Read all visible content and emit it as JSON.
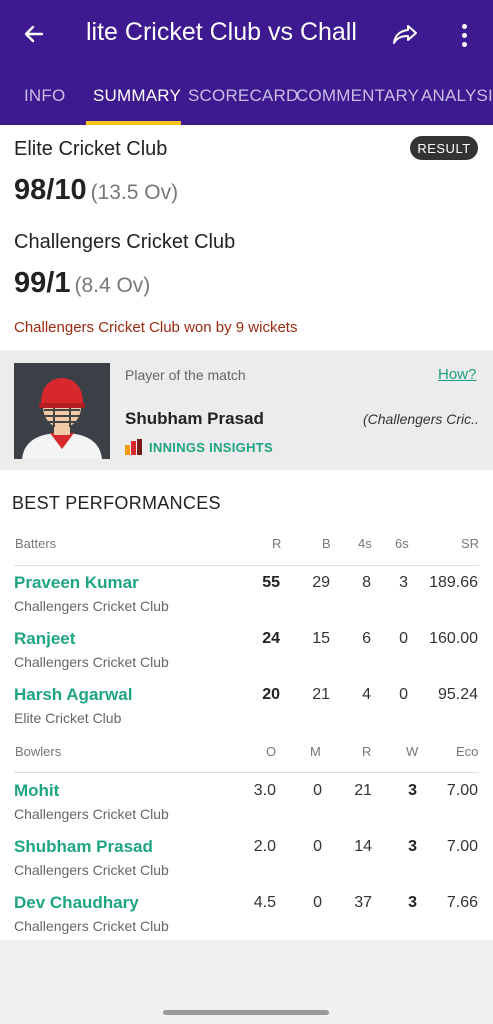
{
  "header": {
    "title": "lite Cricket Club vs Chall",
    "tabs": [
      "INFO",
      "SUMMARY",
      "SCORECARD",
      "COMMENTARY",
      "ANALYSIS"
    ],
    "active_tab": "SUMMARY",
    "accent": "#3d1a8f",
    "tab_highlight": "#f5c518"
  },
  "summary": {
    "team1": {
      "name": "Elite Cricket Club",
      "score": "98/10",
      "overs": "(13.5 Ov)"
    },
    "team2": {
      "name": "Challengers Cricket Club",
      "score": "99/1",
      "overs": "(8.4 Ov)"
    },
    "badge": "RESULT",
    "result": "Challengers Cricket Club won by 9 wickets"
  },
  "potm": {
    "label": "Player of the match",
    "how": "How?",
    "name": "Shubham Prasad",
    "team": "(Challengers Cric..",
    "insights": "INNINGS INSIGHTS"
  },
  "best": {
    "title": "BEST PERFORMANCES",
    "batters_header": {
      "label": "Batters",
      "r": "R",
      "b": "B",
      "fours": "4s",
      "sixes": "6s",
      "sr": "SR"
    },
    "batters": [
      {
        "name": "Praveen Kumar",
        "team": "Challengers Cricket Club",
        "r": "55",
        "b": "29",
        "fours": "8",
        "sixes": "3",
        "sr": "189.66"
      },
      {
        "name": "Ranjeet",
        "team": "Challengers Cricket Club",
        "r": "24",
        "b": "15",
        "fours": "6",
        "sixes": "0",
        "sr": "160.00"
      },
      {
        "name": "Harsh Agarwal",
        "team": "Elite Cricket Club",
        "r": "20",
        "b": "21",
        "fours": "4",
        "sixes": "0",
        "sr": "95.24"
      }
    ],
    "bowlers_header": {
      "label": "Bowlers",
      "o": "O",
      "m": "M",
      "r": "R",
      "w": "W",
      "eco": "Eco"
    },
    "bowlers": [
      {
        "name": "Mohit",
        "team": "Challengers Cricket Club",
        "o": "3.0",
        "m": "0",
        "r": "21",
        "w": "3",
        "eco": "7.00"
      },
      {
        "name": "Shubham Prasad",
        "team": "Challengers Cricket Club",
        "o": "2.0",
        "m": "0",
        "r": "14",
        "w": "3",
        "eco": "7.00"
      },
      {
        "name": "Dev Chaudhary",
        "team": "Challengers Cricket Club",
        "o": "4.5",
        "m": "0",
        "r": "37",
        "w": "3",
        "eco": "7.66"
      }
    ]
  }
}
